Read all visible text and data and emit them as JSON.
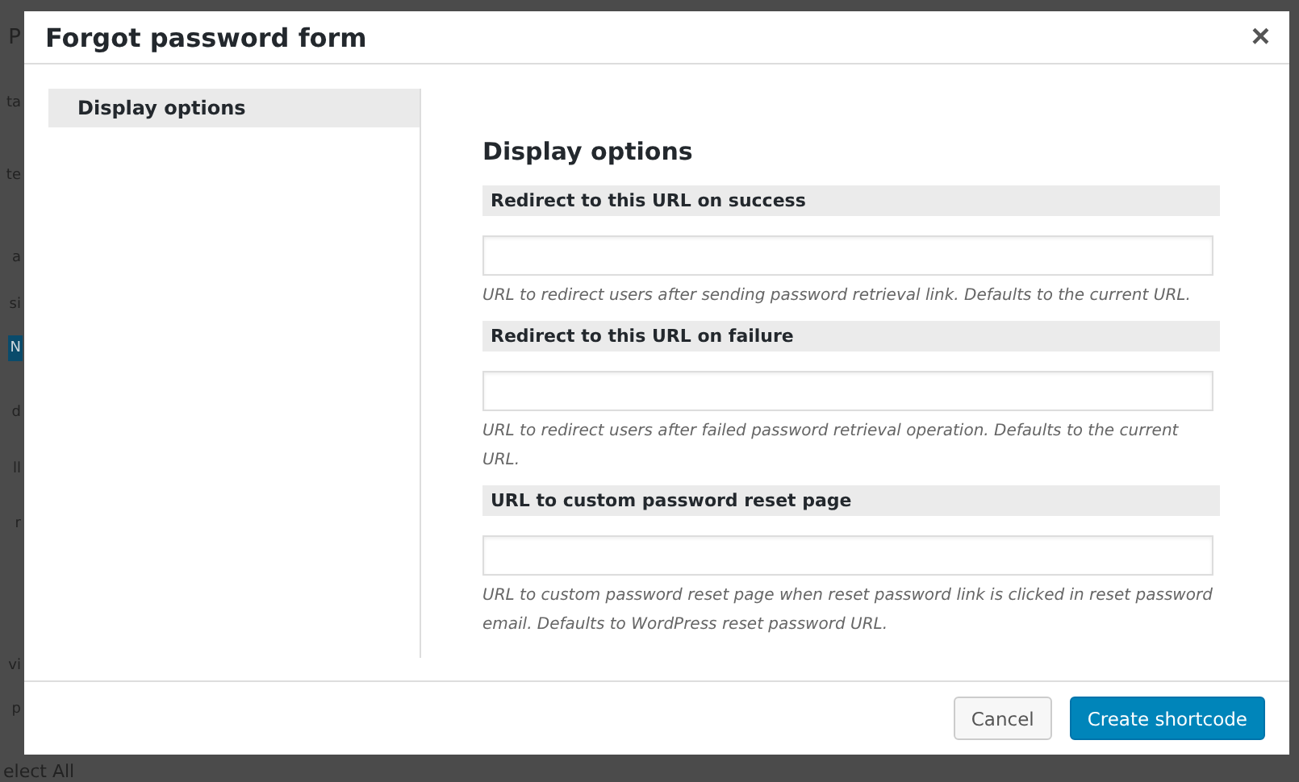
{
  "background_page": {
    "fragments": [
      {
        "text": "P",
        "selected": false
      },
      {
        "text": "ta",
        "selected": false
      },
      {
        "text": "te",
        "selected": false
      },
      {
        "text": "a",
        "selected": false
      },
      {
        "text": "si",
        "selected": false
      },
      {
        "text": "N",
        "selected": true
      },
      {
        "text": "d",
        "selected": false
      },
      {
        "text": "ll",
        "selected": false
      },
      {
        "text": "r",
        "selected": false
      },
      {
        "text": "vi",
        "selected": false
      },
      {
        "text": "p",
        "selected": false
      }
    ],
    "bottom_text": "elect All"
  },
  "dialog": {
    "title": "Forgot password form",
    "close": "×",
    "sidebar": {
      "items": [
        {
          "label": "Display options",
          "selected": true
        }
      ]
    },
    "section_title": "Display options",
    "fields": [
      {
        "label": "Redirect to this URL on success",
        "help": "URL to redirect users after sending password retrieval link. Defaults to the current URL."
      },
      {
        "label": "Redirect to this URL on failure",
        "help": "URL to redirect users after failed password retrieval operation. Defaults to the current URL."
      },
      {
        "label": "URL to custom password reset page",
        "help": "URL to custom password reset page when reset password link is clicked in reset password email. Defaults to WordPress reset password URL."
      }
    ],
    "buttons": [
      {
        "label": "Cancel",
        "kind": "secondary"
      },
      {
        "label": "Create shortcode",
        "kind": "primary"
      }
    ]
  }
}
